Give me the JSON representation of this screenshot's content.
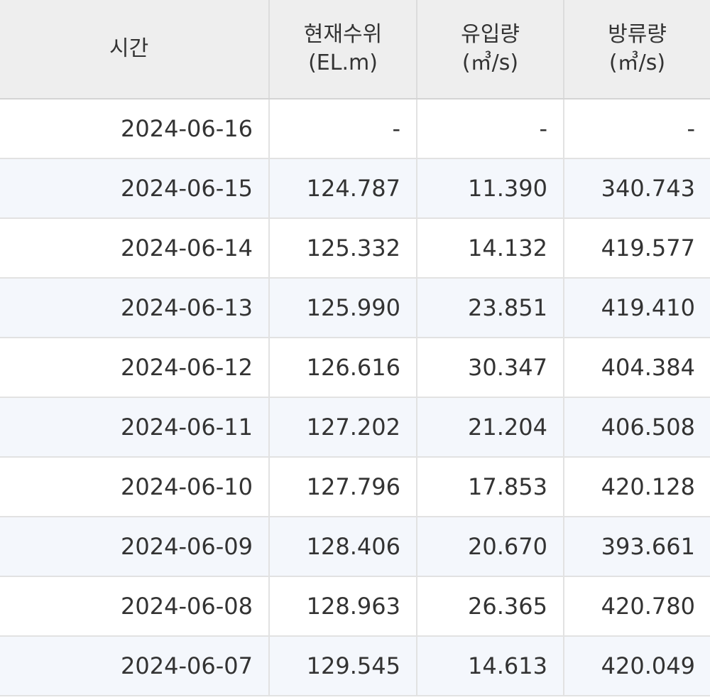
{
  "table": {
    "headers": {
      "time": "시간",
      "level_line1": "현재수위",
      "level_line2": "(EL.m)",
      "inflow_line1": "유입량",
      "inflow_line2": "(㎥/s)",
      "outflow_line1": "방류량",
      "outflow_line2": "(㎥/s)"
    },
    "rows": [
      {
        "date": "2024-06-16",
        "level": "-",
        "inflow": "-",
        "outflow": "-"
      },
      {
        "date": "2024-06-15",
        "level": "124.787",
        "inflow": "11.390",
        "outflow": "340.743"
      },
      {
        "date": "2024-06-14",
        "level": "125.332",
        "inflow": "14.132",
        "outflow": "419.577"
      },
      {
        "date": "2024-06-13",
        "level": "125.990",
        "inflow": "23.851",
        "outflow": "419.410"
      },
      {
        "date": "2024-06-12",
        "level": "126.616",
        "inflow": "30.347",
        "outflow": "404.384"
      },
      {
        "date": "2024-06-11",
        "level": "127.202",
        "inflow": "21.204",
        "outflow": "406.508"
      },
      {
        "date": "2024-06-10",
        "level": "127.796",
        "inflow": "17.853",
        "outflow": "420.128"
      },
      {
        "date": "2024-06-09",
        "level": "128.406",
        "inflow": "20.670",
        "outflow": "393.661"
      },
      {
        "date": "2024-06-08",
        "level": "128.963",
        "inflow": "26.365",
        "outflow": "420.780"
      },
      {
        "date": "2024-06-07",
        "level": "129.545",
        "inflow": "14.613",
        "outflow": "420.049"
      }
    ]
  }
}
